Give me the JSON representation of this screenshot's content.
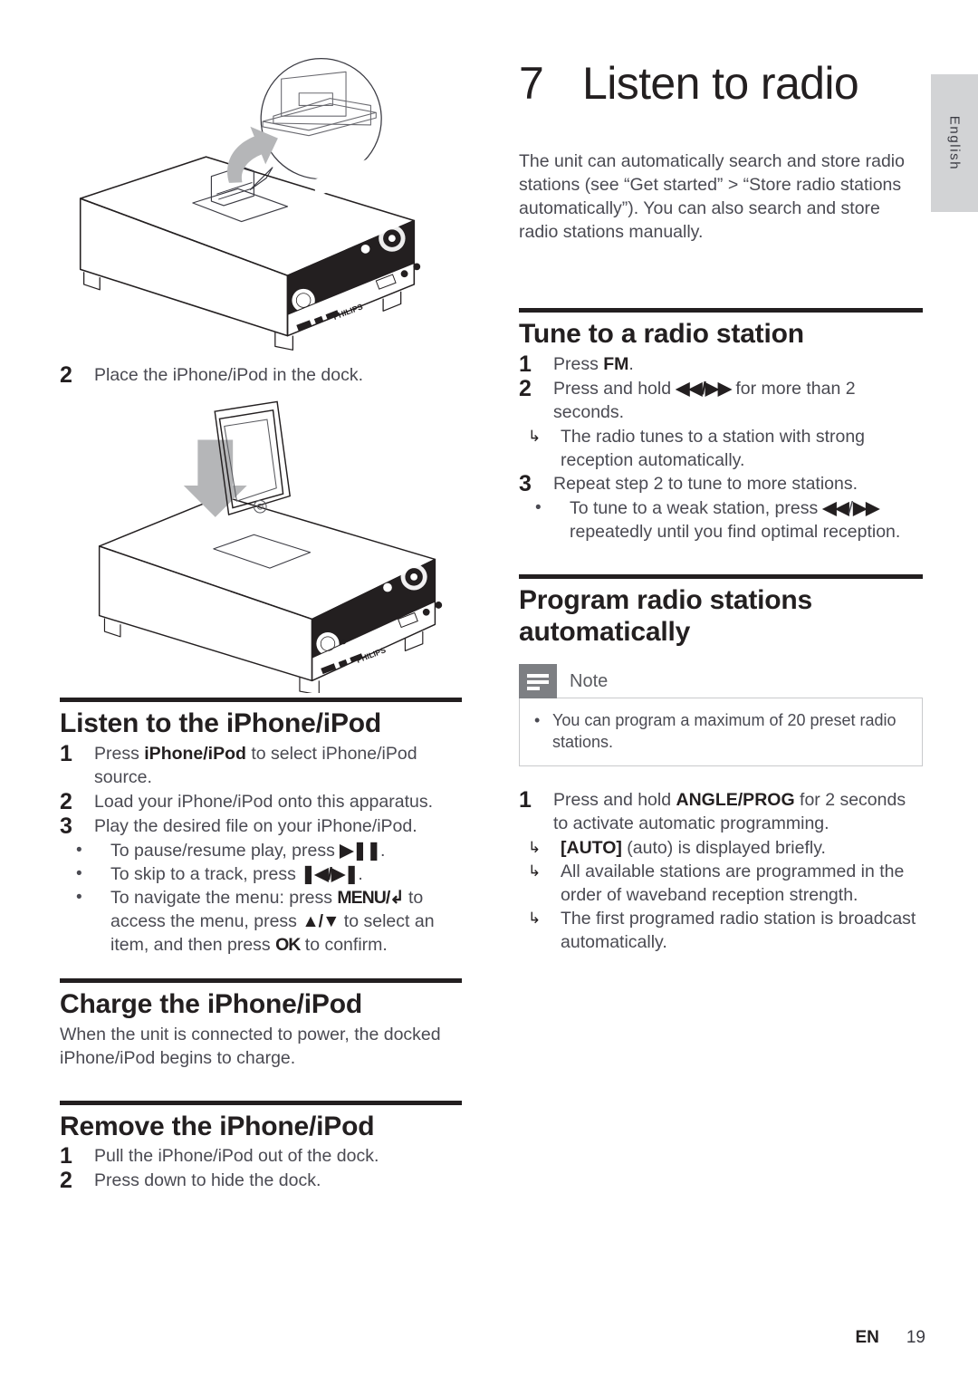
{
  "language_tab": {
    "label": "English"
  },
  "chapter": {
    "number": "7",
    "title": "Listen to radio"
  },
  "intro": "The unit can automatically search and store radio stations (see “Get started” > “Store radio stations automatically”). You can also search and store radio stations manually.",
  "left_column": {
    "illustration_1": {
      "name": "dock-opening-illustration",
      "brand": "PHILIPS",
      "callout": "magnified-dock-detail"
    },
    "step_place": {
      "num": "2",
      "text": "Place the iPhone/iPod in the dock."
    },
    "illustration_2": {
      "name": "iphone-docking-illustration",
      "brand": "PHILIPS",
      "arrow": "down-arrow"
    },
    "sections": [
      {
        "title": "Listen to the iPhone/iPod",
        "steps": [
          {
            "num": "1",
            "text_parts": [
              {
                "t": "Press ",
                "bold": false
              },
              {
                "t": "iPhone/iPod",
                "bold": true
              },
              {
                "t": " to select iPhone/iPod source.",
                "bold": false
              }
            ]
          },
          {
            "num": "2",
            "text_parts": [
              {
                "t": "Load your iPhone/iPod onto this apparatus.",
                "bold": false
              }
            ]
          },
          {
            "num": "3",
            "text_parts": [
              {
                "t": "Play the desired file on your iPhone/iPod.",
                "bold": false
              }
            ]
          }
        ],
        "bullets": [
          {
            "parts": [
              {
                "t": "To pause/resume play, press ",
                "bold": false
              },
              {
                "t": "▶❚❚",
                "sym": true
              },
              {
                "t": ".",
                "bold": false
              }
            ]
          },
          {
            "parts": [
              {
                "t": "To skip to a track, press ",
                "bold": false
              },
              {
                "t": "❚◀/▶❚",
                "sym": true
              },
              {
                "t": ".",
                "bold": false
              }
            ]
          },
          {
            "parts": [
              {
                "t": "To navigate the menu: press ",
                "bold": false
              },
              {
                "t": "MENU/↰",
                "sym": true
              },
              {
                "t": " to access the menu, press ",
                "bold": false
              },
              {
                "t": "▲/▼",
                "sym": true
              },
              {
                "t": " to select an item, and then press ",
                "bold": false
              },
              {
                "t": "OK",
                "sym": true
              },
              {
                "t": " to confirm.",
                "bold": false
              }
            ]
          }
        ]
      },
      {
        "title": "Charge the iPhone/iPod",
        "paragraph": "When the unit is connected to power, the docked iPhone/iPod begins to charge."
      },
      {
        "title": "Remove the iPhone/iPod",
        "steps": [
          {
            "num": "1",
            "text_parts": [
              {
                "t": "Pull the iPhone/iPod out of the dock.",
                "bold": false
              }
            ]
          },
          {
            "num": "2",
            "text_parts": [
              {
                "t": "Press down to hide the dock.",
                "bold": false
              }
            ]
          }
        ]
      }
    ]
  },
  "right_column": {
    "sections": [
      {
        "title": "Tune to a radio station",
        "steps": [
          {
            "num": "1",
            "parts": [
              {
                "t": "Press ",
                "bold": false
              },
              {
                "t": "FM",
                "bold": true
              },
              {
                "t": ".",
                "bold": false
              }
            ]
          },
          {
            "num": "2",
            "parts": [
              {
                "t": "Press and hold ",
                "bold": false
              },
              {
                "t": "◀◀/▶▶",
                "sym": true
              },
              {
                "t": " for more than 2 seconds.",
                "bold": false
              }
            ]
          }
        ],
        "step2_results": [
          "The radio tunes to a station with strong reception automatically."
        ],
        "step3": {
          "num": "3",
          "text": "Repeat step 2 to tune to more stations."
        },
        "step3_bullets": [
          {
            "parts": [
              {
                "t": "To tune to a weak station, press ",
                "bold": false
              },
              {
                "t": "◀◀",
                "sym": true
              },
              {
                "t": "/",
                "bold": false
              },
              {
                "t": "▶▶",
                "sym": true
              },
              {
                "t": " repeatedly until you find optimal reception.",
                "bold": false
              }
            ]
          }
        ]
      },
      {
        "title_line1": "Program radio stations",
        "title_line2": "automatically",
        "note": {
          "label": "Note",
          "items": [
            "You can program a maximum of 20 preset radio stations."
          ]
        },
        "steps": [
          {
            "num": "1",
            "parts": [
              {
                "t": "Press and hold ",
                "bold": false
              },
              {
                "t": "ANGLE/PROG",
                "bold": true
              },
              {
                "t": " for 2 seconds to activate automatic programming.",
                "bold": false
              }
            ]
          }
        ],
        "results": [
          {
            "parts": [
              {
                "t": "[AUTO]",
                "bold": true
              },
              {
                "t": " (auto) is displayed briefly.",
                "bold": false
              }
            ]
          },
          {
            "parts": [
              {
                "t": "All available stations are programmed in the order of waveband reception strength.",
                "bold": false
              }
            ]
          },
          {
            "parts": [
              {
                "t": "The first programed radio station is broadcast automatically.",
                "bold": false
              }
            ]
          }
        ]
      }
    ]
  },
  "footer": {
    "lang_code": "EN",
    "page_number": "19"
  },
  "colors": {
    "text": "#4a4a52",
    "heading": "#231f20",
    "rule": "#231f20",
    "tab_bg": "#d2d3d5",
    "note_icon_bg": "#7d7f83",
    "note_border": "#c9cacc"
  }
}
